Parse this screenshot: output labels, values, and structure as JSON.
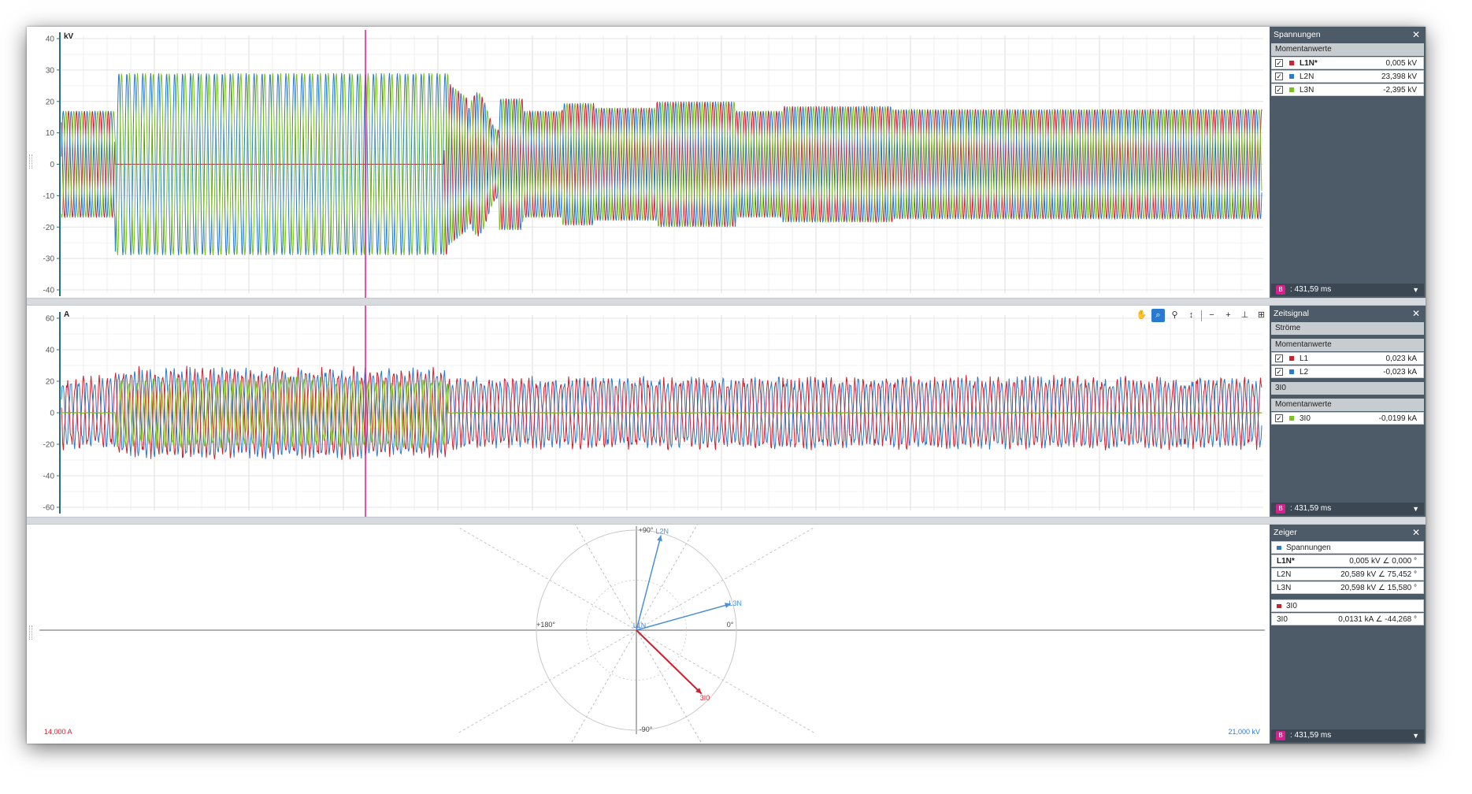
{
  "voltage_panel": {
    "unit": "kV",
    "y_ticks": [
      40,
      30,
      20,
      10,
      0,
      -10,
      -20,
      -30,
      -40
    ],
    "side": {
      "title": "Spannungen",
      "section": "Momentanwerte",
      "rows": [
        {
          "name": "L1N*",
          "value": "0,005 kV",
          "color": "#d0202f",
          "bold": true
        },
        {
          "name": "L2N",
          "value": "23,398 kV",
          "color": "#2a7bd0",
          "bold": false
        },
        {
          "name": "L3N",
          "value": "-2,395 kV",
          "color": "#7ac21e",
          "bold": false
        }
      ],
      "cursor_time": ": 431,59 ms"
    }
  },
  "current_panel": {
    "unit": "A",
    "y_ticks": [
      60,
      40,
      20,
      0,
      -20,
      -40,
      -60
    ],
    "side": {
      "title": "Zeitsignal",
      "group1": "Ströme",
      "section1": "Momentanwerte",
      "rows1": [
        {
          "name": "L1",
          "value": "0,023 kA",
          "color": "#d0202f"
        },
        {
          "name": "L2",
          "value": "-0,023 kA",
          "color": "#2a7bd0"
        }
      ],
      "group2": "3I0",
      "section2": "Momentanwerte",
      "rows2": [
        {
          "name": "3I0",
          "value": "-0,0199 kA",
          "color": "#7ac21e"
        }
      ],
      "cursor_time": ": 431,59 ms"
    },
    "toolbar": [
      "hand-icon",
      "zoom-box-icon",
      "zoom-icon",
      "zoom-y-icon",
      "minus-icon",
      "plus-icon",
      "fit-icon",
      "fit-all-icon"
    ]
  },
  "phasor_panel": {
    "labels": {
      "top": "+90°",
      "bottom": "-90°",
      "left": "+180°",
      "right": "0°"
    },
    "scale_left": "14,000 A",
    "scale_right": "21,000 kV",
    "arrows": [
      {
        "name": "L2N",
        "angle": 75.452,
        "magnitude": 0.98,
        "color": "#4a90d9"
      },
      {
        "name": "L3N",
        "angle": 15.58,
        "magnitude": 0.98,
        "color": "#4a90d9"
      },
      {
        "name": "L1N",
        "angle": 90,
        "magnitude": 0.0,
        "color": "#4a90d9"
      },
      {
        "name": "3I0",
        "angle": -44.268,
        "magnitude": 0.91,
        "color": "#d0202f"
      }
    ],
    "side": {
      "title": "Zeiger",
      "group1": "Spannungen",
      "group1_color": "#2a7bd0",
      "rows1": [
        {
          "name": "L1N*",
          "value": "0,005 kV ∠ 0,000 °",
          "bold": true
        },
        {
          "name": "L2N",
          "value": "20,589 kV ∠ 75,452 °",
          "bold": false
        },
        {
          "name": "L3N",
          "value": "20,598 kV ∠ 15,580 °",
          "bold": false
        }
      ],
      "group2": "3I0",
      "group2_color": "#d0202f",
      "rows2": [
        {
          "name": "3I0",
          "value": "0,0131 kA ∠ -44,268 °",
          "bold": false
        }
      ],
      "cursor_time": ": 431,59 ms"
    }
  },
  "cursor_badge": "B",
  "cursor_color": "#d6208f"
}
